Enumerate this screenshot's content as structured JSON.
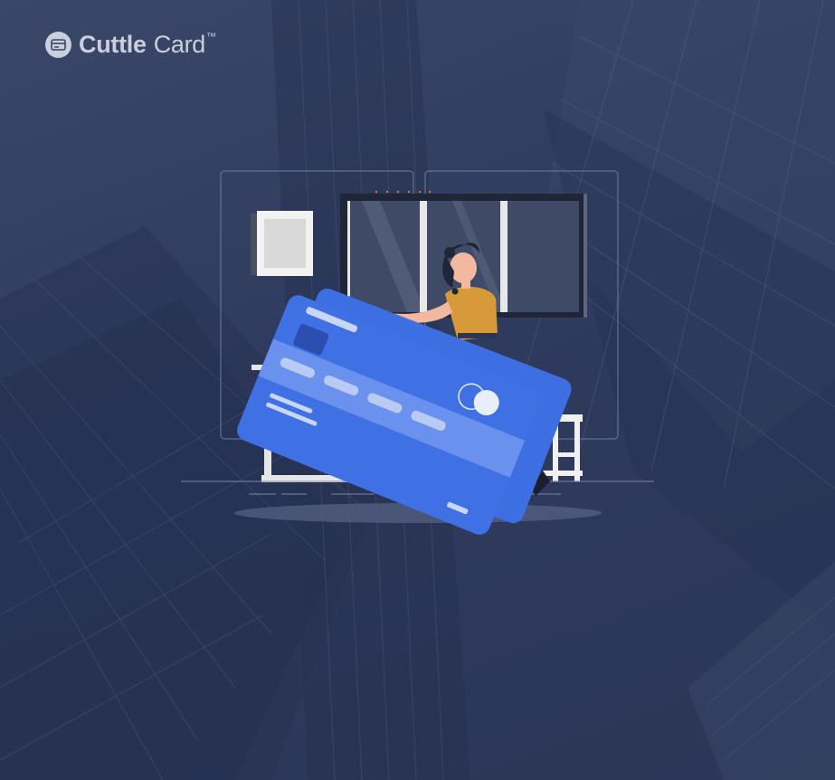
{
  "brand": {
    "name_bold": "Cuttle",
    "name_light": "Card",
    "trademark": "™",
    "icon": "card-logo-icon"
  },
  "colors": {
    "background": "#2e3a5c",
    "card_blue": "#3d6fe3",
    "card_light": "#6f95ee",
    "shirt": "#d69a3a",
    "text": "#c9cfdc"
  },
  "illustration": {
    "subject": "woman-holding-credit-cards",
    "icons": [
      "credit-card-icon",
      "window-icon",
      "picture-frame-icon",
      "stool-icon"
    ]
  }
}
